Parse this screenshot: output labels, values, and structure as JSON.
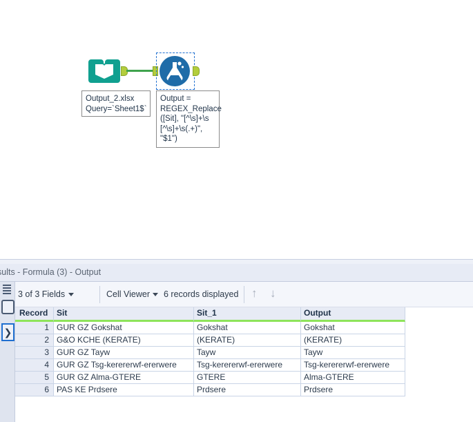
{
  "canvas": {
    "input_tool": {
      "icon": "book-icon",
      "annotation": "Output_2.xlsx\nQuery=`Sheet1$`",
      "color": "#10a090"
    },
    "formula_tool": {
      "icon": "flask-icon",
      "annotation": "Output =\nREGEX_Replace\n([Sit], \"[^\\s]+\\s\n[^\\s]+\\s(.+)\",\n\"$1\")",
      "color": "#1f6ca8",
      "selected": true
    },
    "connector_color": "#3fa34d"
  },
  "results": {
    "title": "sults - Formula (3) - Output",
    "toolbar": {
      "fields_label": "3 of 3 Fields",
      "fields_caret": "chevron-down-icon",
      "check_icon": "check-icon",
      "cell_viewer_label": "Cell Viewer",
      "cell_viewer_caret": "chevron-down-icon",
      "records_label": "6 records displayed",
      "up_arrow": "↑",
      "down_arrow": "↓"
    },
    "left_strip": {
      "icons": [
        "list-lines-icon",
        "square-icon",
        "chevron-right-icon"
      ]
    },
    "grid": {
      "columns": [
        "Record",
        "Sit",
        "Sit_1",
        "Output"
      ],
      "header_underline_color": "#8ee45a",
      "rows": [
        {
          "record": "1",
          "sit": "GUR GZ Gokshat",
          "sit_1": "Gokshat",
          "output": "Gokshat"
        },
        {
          "record": "2",
          "sit": "G&O KCHE (KERATE)",
          "sit_1": "(KERATE)",
          "output": "(KERATE)"
        },
        {
          "record": "3",
          "sit": "GUR GZ Tayw",
          "sit_1": "Tayw",
          "output": "Tayw"
        },
        {
          "record": "4",
          "sit": "GUR GZ Tsg-kerererwf-ererwere",
          "sit_1": "Tsg-kerererwf-ererwere",
          "output": "Tsg-kerererwf-ererwere"
        },
        {
          "record": "5",
          "sit": "GUR GZ Alma-GTERE",
          "sit_1": "GTERE",
          "output": "Alma-GTERE"
        },
        {
          "record": "6",
          "sit": "PAS KE Prdsere",
          "sit_1": "Prdsere",
          "output": "Prdsere"
        }
      ]
    }
  }
}
